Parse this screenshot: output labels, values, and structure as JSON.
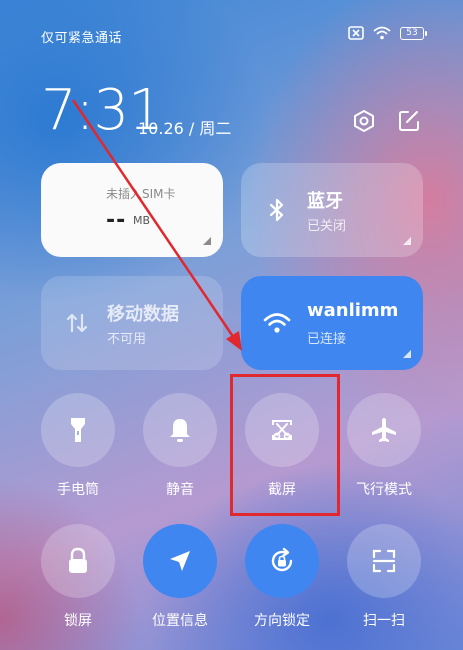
{
  "status_bar": {
    "carrier": "仅可紧急通话",
    "battery": "53",
    "icons": [
      "no-sim-icon",
      "wifi-icon",
      "battery-icon"
    ]
  },
  "header": {
    "time": "7:31",
    "date": "10.26 / 周二",
    "icons": [
      "settings-icon",
      "edit-icon"
    ]
  },
  "tiles": {
    "sim": {
      "line1": "未插入SIM卡",
      "value": "--",
      "unit": "MB"
    },
    "bluetooth": {
      "title": "蓝牙",
      "status": "已关闭",
      "icon": "bluetooth-icon"
    },
    "mobile_data": {
      "title": "移动数据",
      "status": "不可用",
      "icon": "mobile-data-icon"
    },
    "wifi": {
      "title": "wanlimm",
      "status": "已连接",
      "icon": "wifi-icon"
    }
  },
  "buttons": [
    {
      "label": "手电筒",
      "icon": "flashlight-icon",
      "active": false
    },
    {
      "label": "静音",
      "icon": "bell-icon",
      "active": false
    },
    {
      "label": "截屏",
      "icon": "screenshot-icon",
      "active": false
    },
    {
      "label": "飞行模式",
      "icon": "airplane-icon",
      "active": false
    },
    {
      "label": "锁屏",
      "icon": "lock-icon",
      "active": false
    },
    {
      "label": "位置信息",
      "icon": "location-icon",
      "active": true
    },
    {
      "label": "方向锁定",
      "icon": "rotation-lock-icon",
      "active": true
    },
    {
      "label": "扫一扫",
      "icon": "scan-icon",
      "active": false
    }
  ],
  "colors": {
    "accent": "#3f86f0",
    "highlight": "#e0282e"
  }
}
